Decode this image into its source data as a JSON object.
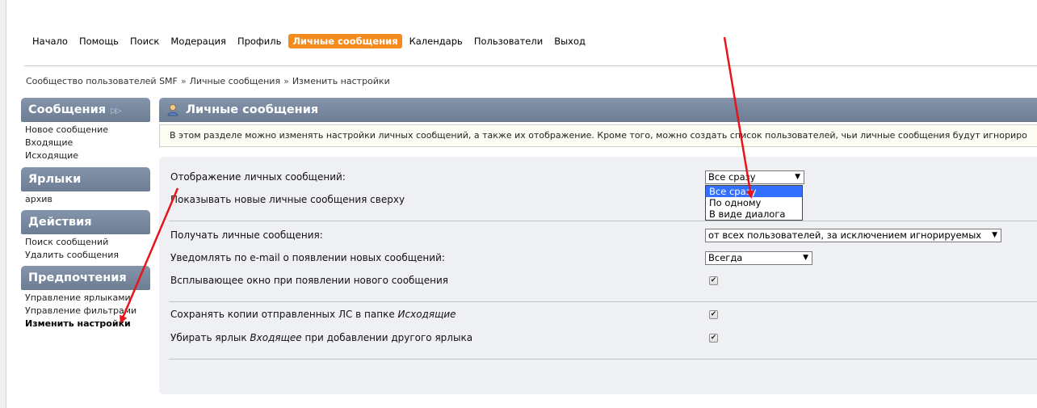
{
  "nav": {
    "items": [
      "Начало",
      "Помощь",
      "Поиск",
      "Модерация",
      "Профиль",
      "Личные сообщения",
      "Календарь",
      "Пользователи",
      "Выход"
    ],
    "active_index": 5
  },
  "breadcrumb": [
    "Сообщество пользователей SMF",
    "Личные сообщения",
    "Изменить настройки"
  ],
  "breadcrumb_separator": "»",
  "sidebar": {
    "sections": [
      {
        "title": "Сообщения",
        "items": [
          "Новое сообщение",
          "Входящие",
          "Исходящие"
        ]
      },
      {
        "title": "Ярлыки",
        "items": [
          "архив"
        ]
      },
      {
        "title": "Действия",
        "items": [
          "Поиск сообщений",
          "Удалить сообщения"
        ]
      },
      {
        "title": "Предпочтения",
        "items": [
          "Управление ярлыками",
          "Управление фильтрами",
          "Изменить настройки"
        ]
      }
    ],
    "current_item": "Изменить настройки",
    "expand_glyph": "▷▷"
  },
  "main": {
    "title": "Личные сообщения",
    "description": "В этом разделе можно изменять настройки личных сообщений, а также их отображение. Кроме того, можно создать список пользователей, чьи личные сообщения будут игнориро",
    "settings": {
      "display_label": "Отображение личных сообщений:",
      "display_value": "Все сразу",
      "display_options": [
        "Все сразу",
        "По одному",
        "В виде диалога"
      ],
      "show_new_on_top_label": "Показывать новые личные сообщения сверху",
      "receive_label": "Получать личные сообщения:",
      "receive_value": "от всех пользователей, за исключением игнорируемых",
      "email_label": "Уведомлять по e-mail о появлении новых сообщений:",
      "email_value": "Всегда",
      "popup_label": "Всплывающее окно при появлении нового сообщения",
      "popup_checked": true,
      "save_copy_prefix": "Сохранять копии отправленных ЛС в папке ",
      "save_copy_folder": "Исходящие",
      "save_copy_checked": true,
      "remove_label_prefix": "Убирать ярлык ",
      "remove_label_name": "Входящее",
      "remove_label_suffix": " при добавлении другого ярлыка",
      "remove_label_checked": true,
      "caret": "▼",
      "check_glyph": "✔"
    }
  },
  "colors": {
    "accent_nav": "#f58b1d",
    "header_bg": "#7485a0",
    "option_highlight": "#3370ff",
    "annotation_arrow": "#e8141a"
  }
}
